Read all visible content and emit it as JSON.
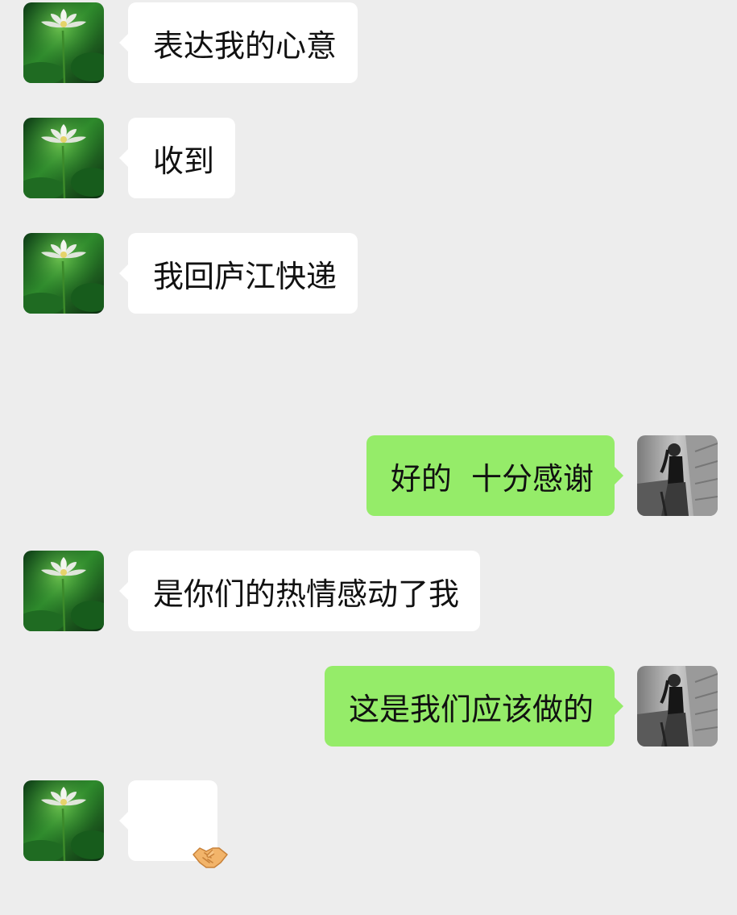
{
  "colors": {
    "background": "#ededed",
    "incoming_bubble": "#ffffff",
    "outgoing_bubble": "#95ec69"
  },
  "contact_avatar_icon": "lotus-avatar",
  "self_avatar_icon": "woman-photo-avatar",
  "messages": [
    {
      "direction": "incoming",
      "text": "表达我的心意"
    },
    {
      "direction": "incoming",
      "text": "收到"
    },
    {
      "direction": "incoming",
      "text": "我回庐江快递"
    },
    {
      "direction": "outgoing",
      "text": "好的  十分感谢"
    },
    {
      "direction": "incoming",
      "text": "是你们的热情感动了我"
    },
    {
      "direction": "outgoing",
      "text": "这是我们应该做的"
    },
    {
      "direction": "incoming",
      "emoji": "handshake-emoji"
    }
  ]
}
